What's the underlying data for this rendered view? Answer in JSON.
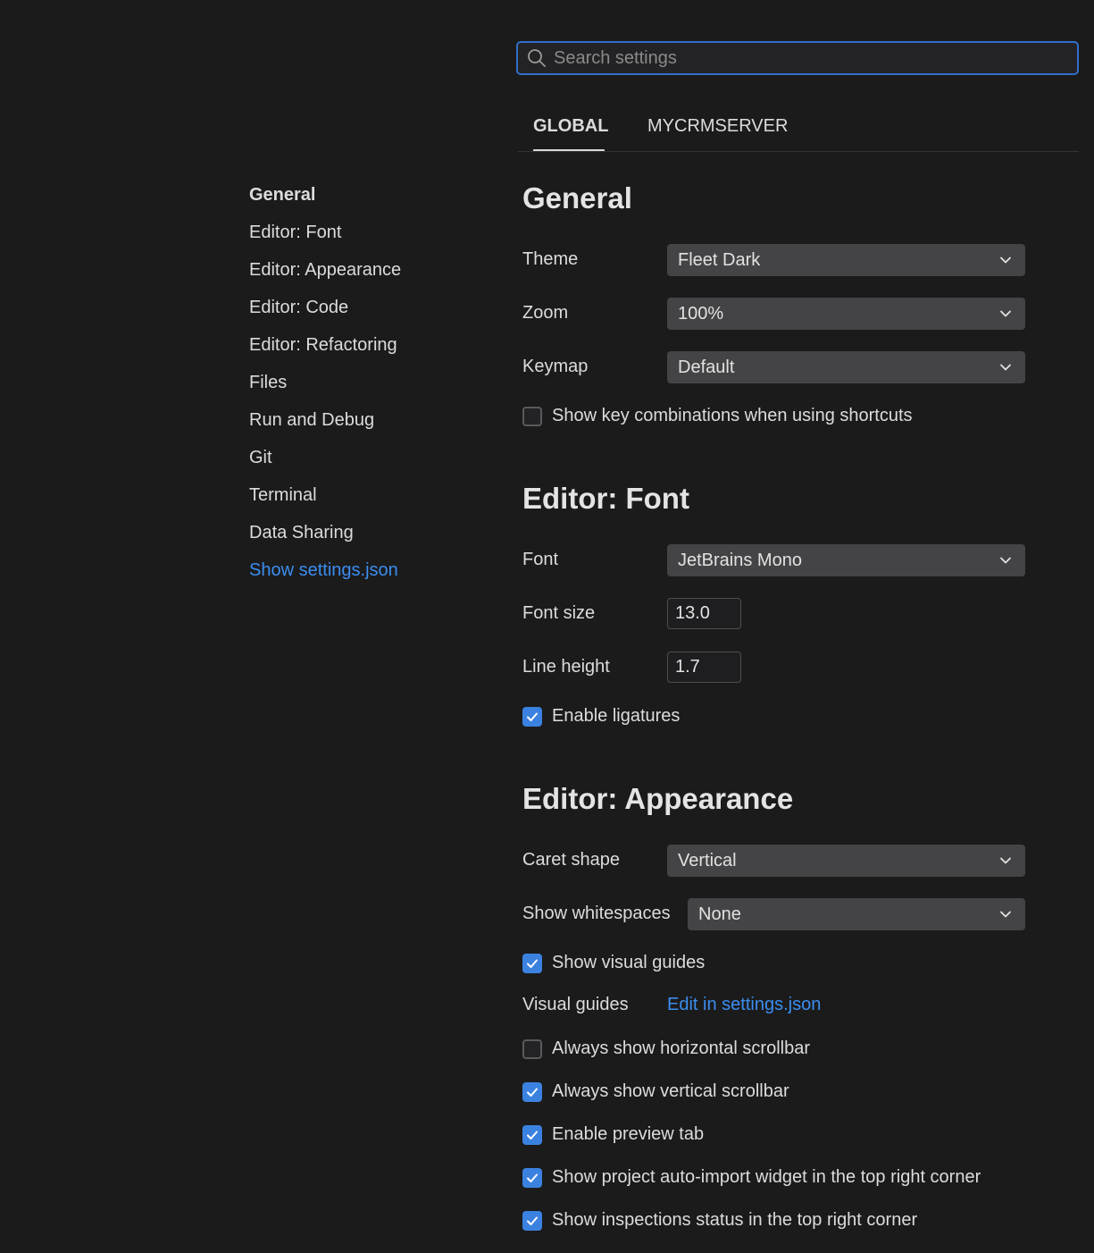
{
  "search": {
    "placeholder": "Search settings"
  },
  "tabs": [
    {
      "label": "GLOBAL",
      "active": true
    },
    {
      "label": "MYCRMSERVER",
      "active": false
    }
  ],
  "sidebar": {
    "items": [
      {
        "label": "General",
        "active": true
      },
      {
        "label": "Editor: Font"
      },
      {
        "label": "Editor: Appearance"
      },
      {
        "label": "Editor: Code"
      },
      {
        "label": "Editor: Refactoring"
      },
      {
        "label": "Files"
      },
      {
        "label": "Run and Debug"
      },
      {
        "label": "Git"
      },
      {
        "label": "Terminal"
      },
      {
        "label": "Data Sharing"
      }
    ],
    "settings_link": "Show settings.json"
  },
  "general": {
    "title": "General",
    "theme": {
      "label": "Theme",
      "value": "Fleet Dark"
    },
    "zoom": {
      "label": "Zoom",
      "value": "100%"
    },
    "keymap": {
      "label": "Keymap",
      "value": "Default"
    },
    "show_key_combinations": {
      "label": "Show key combinations when using shortcuts",
      "checked": false
    }
  },
  "editor_font": {
    "title": "Editor: Font",
    "font": {
      "label": "Font",
      "value": "JetBrains Mono"
    },
    "font_size": {
      "label": "Font size",
      "value": "13.0"
    },
    "line_height": {
      "label": "Line height",
      "value": "1.7"
    },
    "enable_ligatures": {
      "label": "Enable ligatures",
      "checked": true
    }
  },
  "editor_appearance": {
    "title": "Editor: Appearance",
    "caret_shape": {
      "label": "Caret shape",
      "value": "Vertical"
    },
    "show_whitespaces": {
      "label": "Show whitespaces",
      "value": "None"
    },
    "show_visual_guides": {
      "label": "Show visual guides",
      "checked": true
    },
    "visual_guides": {
      "label": "Visual guides",
      "link": "Edit in settings.json"
    },
    "horizontal_scrollbar": {
      "label": "Always show horizontal scrollbar",
      "checked": false
    },
    "vertical_scrollbar": {
      "label": "Always show vertical scrollbar",
      "checked": true
    },
    "preview_tab": {
      "label": "Enable preview tab",
      "checked": true
    },
    "auto_import_widget": {
      "label": "Show project auto-import widget in the top right corner",
      "checked": true
    },
    "inspections_status": {
      "label": "Show inspections status in the top right corner",
      "checked": true
    }
  },
  "colors": {
    "background": "#1b1b1c",
    "accent": "#3b82e0",
    "link": "#3b8ef0",
    "dropdown_bg": "#444446"
  }
}
